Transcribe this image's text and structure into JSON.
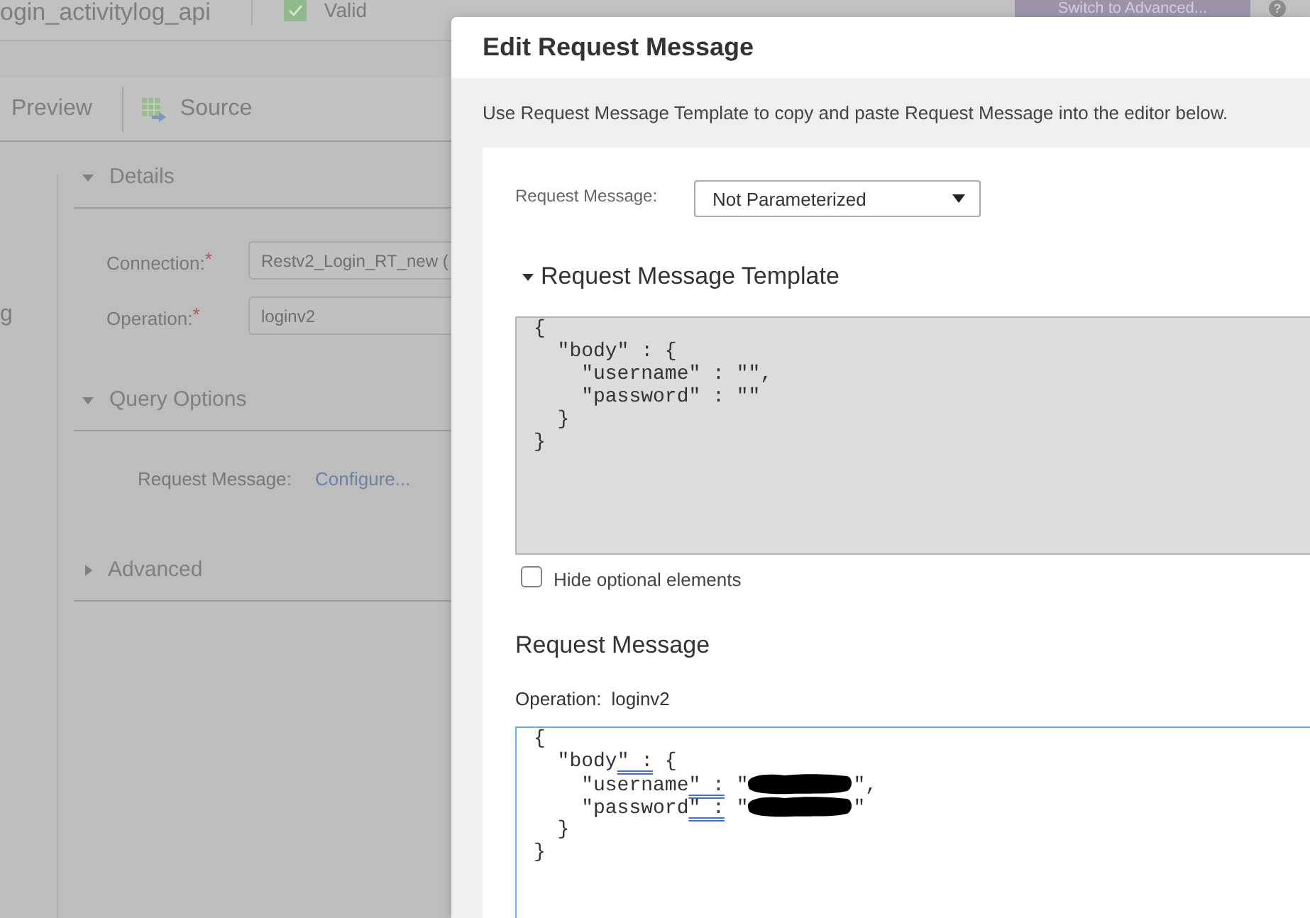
{
  "background_page": {
    "header": {
      "title": "ogin_activitylog_api",
      "status": "Valid",
      "switch_button": "Switch to Advanced...",
      "help_button": "?"
    },
    "toolbar": [
      {
        "kind": "label",
        "label": "Preview"
      },
      {
        "kind": "icon_label",
        "label": "Source"
      }
    ],
    "sidebar_fragment": "g",
    "sections": [
      {
        "title": "Details",
        "expanded": true,
        "items": [
          {
            "kind": "field",
            "label": "Connection:",
            "required_mark": "*",
            "value": "Restv2_Login_RT_new ("
          },
          {
            "kind": "field",
            "label": "Operation:",
            "required_mark": "*",
            "value": "loginv2"
          }
        ]
      },
      {
        "title": "Query Options",
        "expanded": true,
        "items": [
          {
            "kind": "link",
            "label": "Request Message:",
            "value": "Configure..."
          }
        ]
      },
      {
        "title": "Advanced",
        "expanded": false
      }
    ]
  },
  "dialog": {
    "title": "Edit Request Message",
    "description": "Use Request Message Template to copy and paste Request Message into the editor below.",
    "request_message": {
      "label": "Request Message:",
      "value": "Not Parameterized"
    },
    "template": {
      "title": "Request Message Template",
      "expanded": true,
      "lines": [
        "{",
        "  \"body\" : {",
        "    \"username\" : \"\",",
        "    \"password\" : \"\"",
        "  }",
        "}"
      ]
    },
    "hide_optional": {
      "label": "Hide optional elements",
      "checked": false
    },
    "editor": {
      "title": "Request Message",
      "operation_label": "Operation:",
      "operation_value": "loginv2",
      "lines": [
        [
          {
            "kind": "text",
            "text": "{"
          }
        ],
        [
          {
            "kind": "text",
            "text": "  \"body"
          },
          {
            "kind": "marked",
            "text": "\" :"
          },
          {
            "kind": "text",
            "text": " {"
          }
        ],
        [
          {
            "kind": "text",
            "text": "    \"username"
          },
          {
            "kind": "marked",
            "text": "\" :"
          },
          {
            "kind": "text",
            "text": " \""
          },
          {
            "kind": "redacted"
          },
          {
            "kind": "text",
            "text": "\","
          }
        ],
        [
          {
            "kind": "text",
            "text": "    \"password"
          },
          {
            "kind": "marked",
            "text": "\" :"
          },
          {
            "kind": "text",
            "text": " \""
          },
          {
            "kind": "redacted"
          },
          {
            "kind": "text",
            "text": "\""
          }
        ],
        [
          {
            "kind": "text",
            "text": "  }"
          }
        ],
        [
          {
            "kind": "text",
            "text": "}"
          }
        ]
      ]
    }
  }
}
